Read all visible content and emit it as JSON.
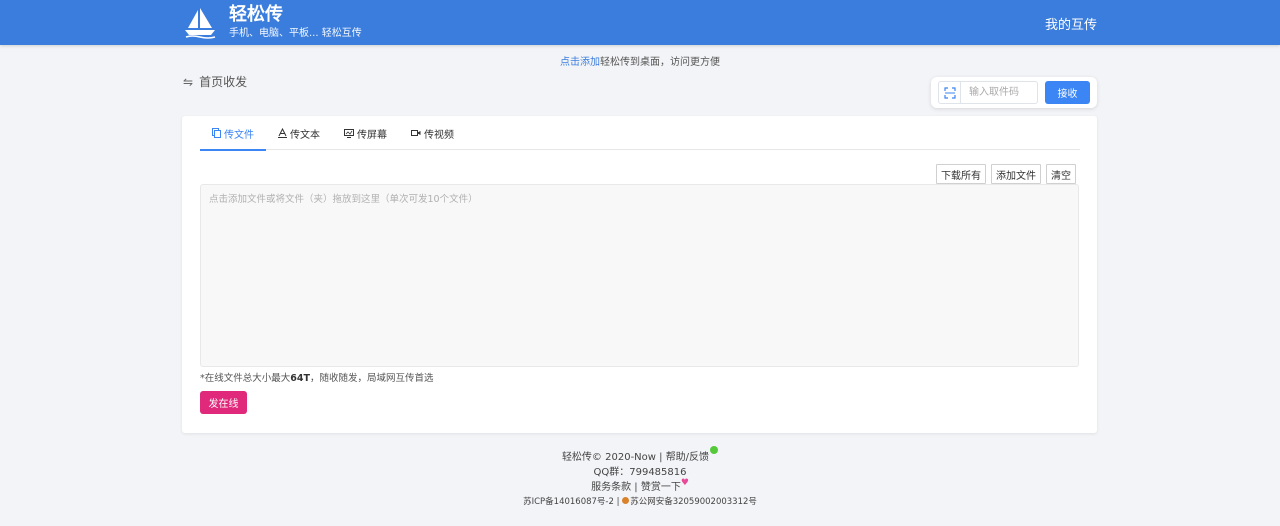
{
  "header": {
    "app_title": "轻松传",
    "app_subtitle": "手机、电脑、平板... 轻松互传",
    "my_transfers": "我的互传",
    "colors": {
      "bar": "#3b7ddd"
    }
  },
  "hint": {
    "link_text": "点击添加",
    "rest": "轻松传到桌面，访问更方便"
  },
  "breadcrumb": {
    "icon": "swap-arrows-icon",
    "label": "首页收发"
  },
  "receive": {
    "placeholder": "输入取件码",
    "value": "",
    "button": "接收"
  },
  "tabs": [
    {
      "label": "传文件",
      "icon": "copy-icon",
      "active": true
    },
    {
      "label": "传文本",
      "icon": "text-icon",
      "active": false
    },
    {
      "label": "传屏幕",
      "icon": "screen-icon",
      "active": false
    },
    {
      "label": "传视频",
      "icon": "video-icon",
      "active": false
    }
  ],
  "actions": {
    "download_all": "下载所有",
    "add_file": "添加文件",
    "clear": "清空"
  },
  "dropzone": {
    "text": "点击添加文件或将文件（夹）拖放到这里（单次可发10个文件）"
  },
  "note": {
    "prefix": "*在线文件总大小最大",
    "size": "64T",
    "suffix": "，随收随发，局域网互传首选"
  },
  "send_button": "发在线",
  "footer": {
    "copyright": "轻松传© 2020-Now",
    "sep": " | ",
    "help": "帮助/反馈",
    "qq": "QQ群：799485816",
    "terms": "服务条款",
    "donate": "赞赏一下",
    "icp": "苏ICP备14016087号-2",
    "police": "苏公网安备32059002003312号"
  },
  "colors": {
    "accent": "#3b85f5",
    "send": "#e0297a"
  }
}
